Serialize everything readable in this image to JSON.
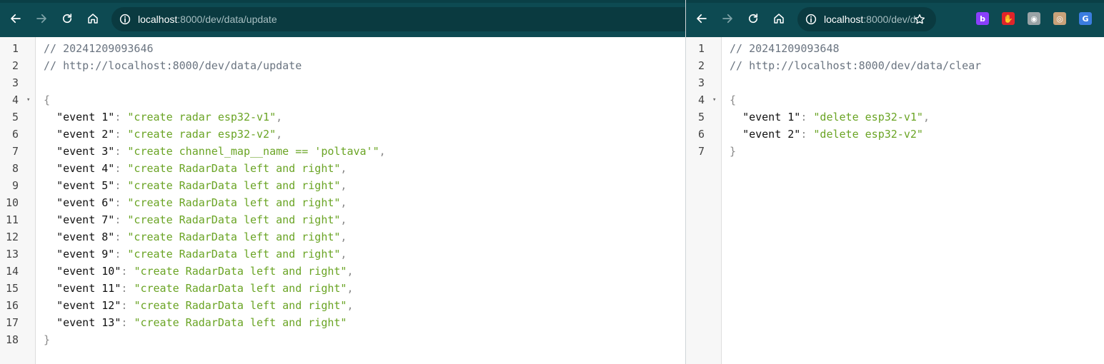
{
  "colors": {
    "toolbar": "#0d4a52",
    "omnibox": "#0a3a40",
    "string": "#6aa424",
    "comment": "#6a7480"
  },
  "left": {
    "url_host": "localhost",
    "url_path": ":8000/dev/data/update",
    "lines": [
      {
        "n": "1",
        "type": "comment",
        "text": "// 20241209093646"
      },
      {
        "n": "2",
        "type": "comment",
        "text": "// http://localhost:8000/dev/data/update"
      },
      {
        "n": "3",
        "type": "blank",
        "text": ""
      },
      {
        "n": "4",
        "type": "open",
        "text": "{",
        "fold": "▾"
      },
      {
        "n": "5",
        "type": "kv",
        "key": "\"event 1\"",
        "sep": ": ",
        "value": "\"create radar esp32-v1\"",
        "trail": ","
      },
      {
        "n": "6",
        "type": "kv",
        "key": "\"event 2\"",
        "sep": ": ",
        "value": "\"create radar esp32-v2\"",
        "trail": ","
      },
      {
        "n": "7",
        "type": "kv",
        "key": "\"event 3\"",
        "sep": ": ",
        "value": "\"create channel_map__name == 'poltava'\"",
        "trail": ","
      },
      {
        "n": "8",
        "type": "kv",
        "key": "\"event 4\"",
        "sep": ": ",
        "value": "\"create RadarData left and right\"",
        "trail": ","
      },
      {
        "n": "9",
        "type": "kv",
        "key": "\"event 5\"",
        "sep": ": ",
        "value": "\"create RadarData left and right\"",
        "trail": ","
      },
      {
        "n": "10",
        "type": "kv",
        "key": "\"event 6\"",
        "sep": ": ",
        "value": "\"create RadarData left and right\"",
        "trail": ","
      },
      {
        "n": "11",
        "type": "kv",
        "key": "\"event 7\"",
        "sep": ": ",
        "value": "\"create RadarData left and right\"",
        "trail": ","
      },
      {
        "n": "12",
        "type": "kv",
        "key": "\"event 8\"",
        "sep": ": ",
        "value": "\"create RadarData left and right\"",
        "trail": ","
      },
      {
        "n": "13",
        "type": "kv",
        "key": "\"event 9\"",
        "sep": ": ",
        "value": "\"create RadarData left and right\"",
        "trail": ","
      },
      {
        "n": "14",
        "type": "kv",
        "key": "\"event 10\"",
        "sep": ": ",
        "value": "\"create RadarData left and right\"",
        "trail": ","
      },
      {
        "n": "15",
        "type": "kv",
        "key": "\"event 11\"",
        "sep": ": ",
        "value": "\"create RadarData left and right\"",
        "trail": ","
      },
      {
        "n": "16",
        "type": "kv",
        "key": "\"event 12\"",
        "sep": ": ",
        "value": "\"create RadarData left and right\"",
        "trail": ","
      },
      {
        "n": "17",
        "type": "kv",
        "key": "\"event 13\"",
        "sep": ": ",
        "value": "\"create RadarData left and right\"",
        "trail": ""
      },
      {
        "n": "18",
        "type": "close",
        "text": "}"
      }
    ]
  },
  "right": {
    "url_host": "localhost",
    "url_path": ":8000/dev/d...",
    "lines": [
      {
        "n": "1",
        "type": "comment",
        "text": "// 20241209093648"
      },
      {
        "n": "2",
        "type": "comment",
        "text": "// http://localhost:8000/dev/data/clear"
      },
      {
        "n": "3",
        "type": "blank",
        "text": ""
      },
      {
        "n": "4",
        "type": "open",
        "text": "{",
        "fold": "▾"
      },
      {
        "n": "5",
        "type": "kv",
        "key": "\"event 1\"",
        "sep": ": ",
        "value": "\"delete esp32-v1\"",
        "trail": ","
      },
      {
        "n": "6",
        "type": "kv",
        "key": "\"event 2\"",
        "sep": ": ",
        "value": "\"delete esp32-v2\"",
        "trail": ""
      },
      {
        "n": "7",
        "type": "close",
        "text": "}"
      }
    ]
  },
  "extensions": [
    {
      "name": "bitwarden-extension-icon",
      "color": "#8a3ffc",
      "glyph": "b"
    },
    {
      "name": "adblock-extension-icon",
      "color": "#e0242a",
      "glyph": "✋"
    },
    {
      "name": "screenshot-extension-icon",
      "color": "#9aa3a6",
      "glyph": "◉"
    },
    {
      "name": "glasses-extension-icon",
      "color": "#c9a27a",
      "glyph": "◎"
    },
    {
      "name": "translate-extension-icon",
      "color": "#3b7de0",
      "glyph": "G"
    }
  ]
}
